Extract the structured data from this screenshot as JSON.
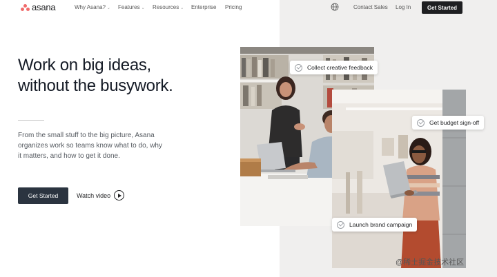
{
  "brand": {
    "name": "asana",
    "logo_color": "#f06a6a"
  },
  "nav": {
    "items": [
      {
        "label": "Why Asana?",
        "has_dropdown": true
      },
      {
        "label": "Features",
        "has_dropdown": true
      },
      {
        "label": "Resources",
        "has_dropdown": true
      },
      {
        "label": "Enterprise",
        "has_dropdown": false
      },
      {
        "label": "Pricing",
        "has_dropdown": false
      }
    ],
    "globe_icon": "globe-icon",
    "contact_sales": "Contact Sales",
    "login": "Log In",
    "get_started": "Get Started"
  },
  "hero": {
    "headline_line1": "Work on big ideas,",
    "headline_line2": "without the busywork.",
    "subtext": "From the small stuff to the big picture, Asana organizes work so teams know what to do, why it matters, and how to get it done.",
    "cta": "Get Started",
    "watch_video": "Watch video"
  },
  "tags": {
    "feedback": "Collect creative feedback",
    "budget": "Get budget sign-off",
    "launch": "Launch brand campaign"
  },
  "watermark": "@稀土掘金技术社区",
  "colors": {
    "dark_button": "#1e1f21",
    "cta_button": "#2b3440",
    "right_panel": "#f0efee"
  }
}
